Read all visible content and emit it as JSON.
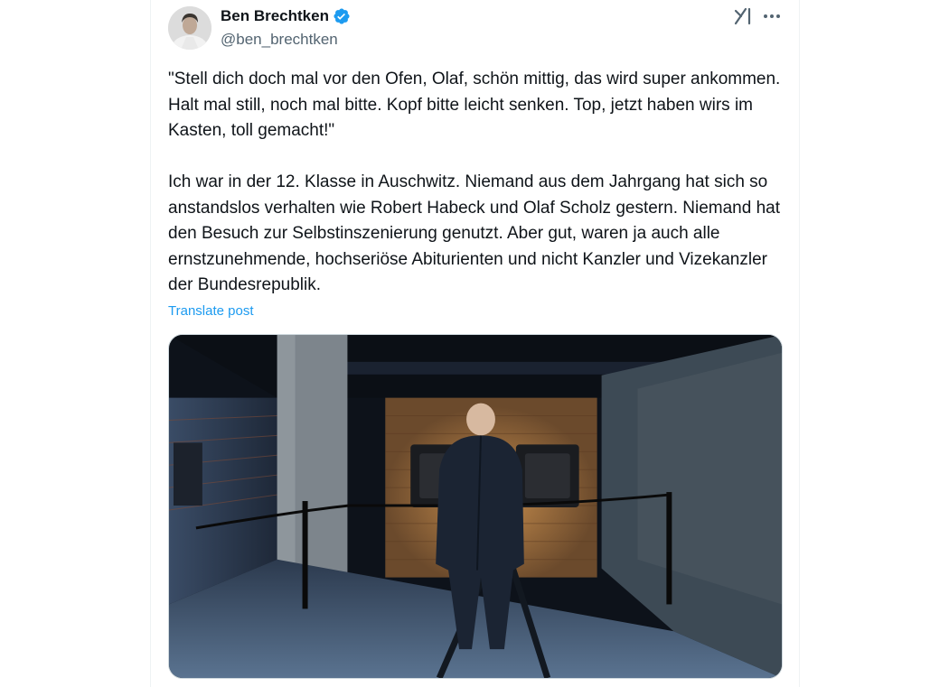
{
  "author": {
    "display_name": "Ben Brechtken",
    "handle": "@ben_brechtken",
    "verified": true,
    "verified_color": "#1d9bf0"
  },
  "tweet": {
    "paragraph_1": "\"Stell dich doch mal vor den Ofen, Olaf, schön mittig, das wird super ankommen. Halt mal still, noch mal bitte. Kopf bitte leicht senken. Top, jetzt haben wirs im Kasten, toll gemacht!\"",
    "paragraph_2": "Ich war in der 12. Klasse in Auschwitz. Niemand aus dem Jahrgang hat sich so anstandslos verhalten wie Robert Habeck und Olaf Scholz gestern. Niemand hat den Besuch zur Selbstinszenierung genutzt. Aber gut, waren ja auch alle ernstzunehmende, hochseriöse Abiturienten und nicht Kanzler und Vizekanzler der Bundesrepublik.",
    "translate_label": "Translate post"
  },
  "icons": {
    "grok": "grok-icon",
    "more": "more-dots-icon",
    "verified": "verified-badge-icon"
  },
  "colors": {
    "link": "#1d9bf0",
    "text": "#0f1419",
    "secondary": "#536471"
  }
}
